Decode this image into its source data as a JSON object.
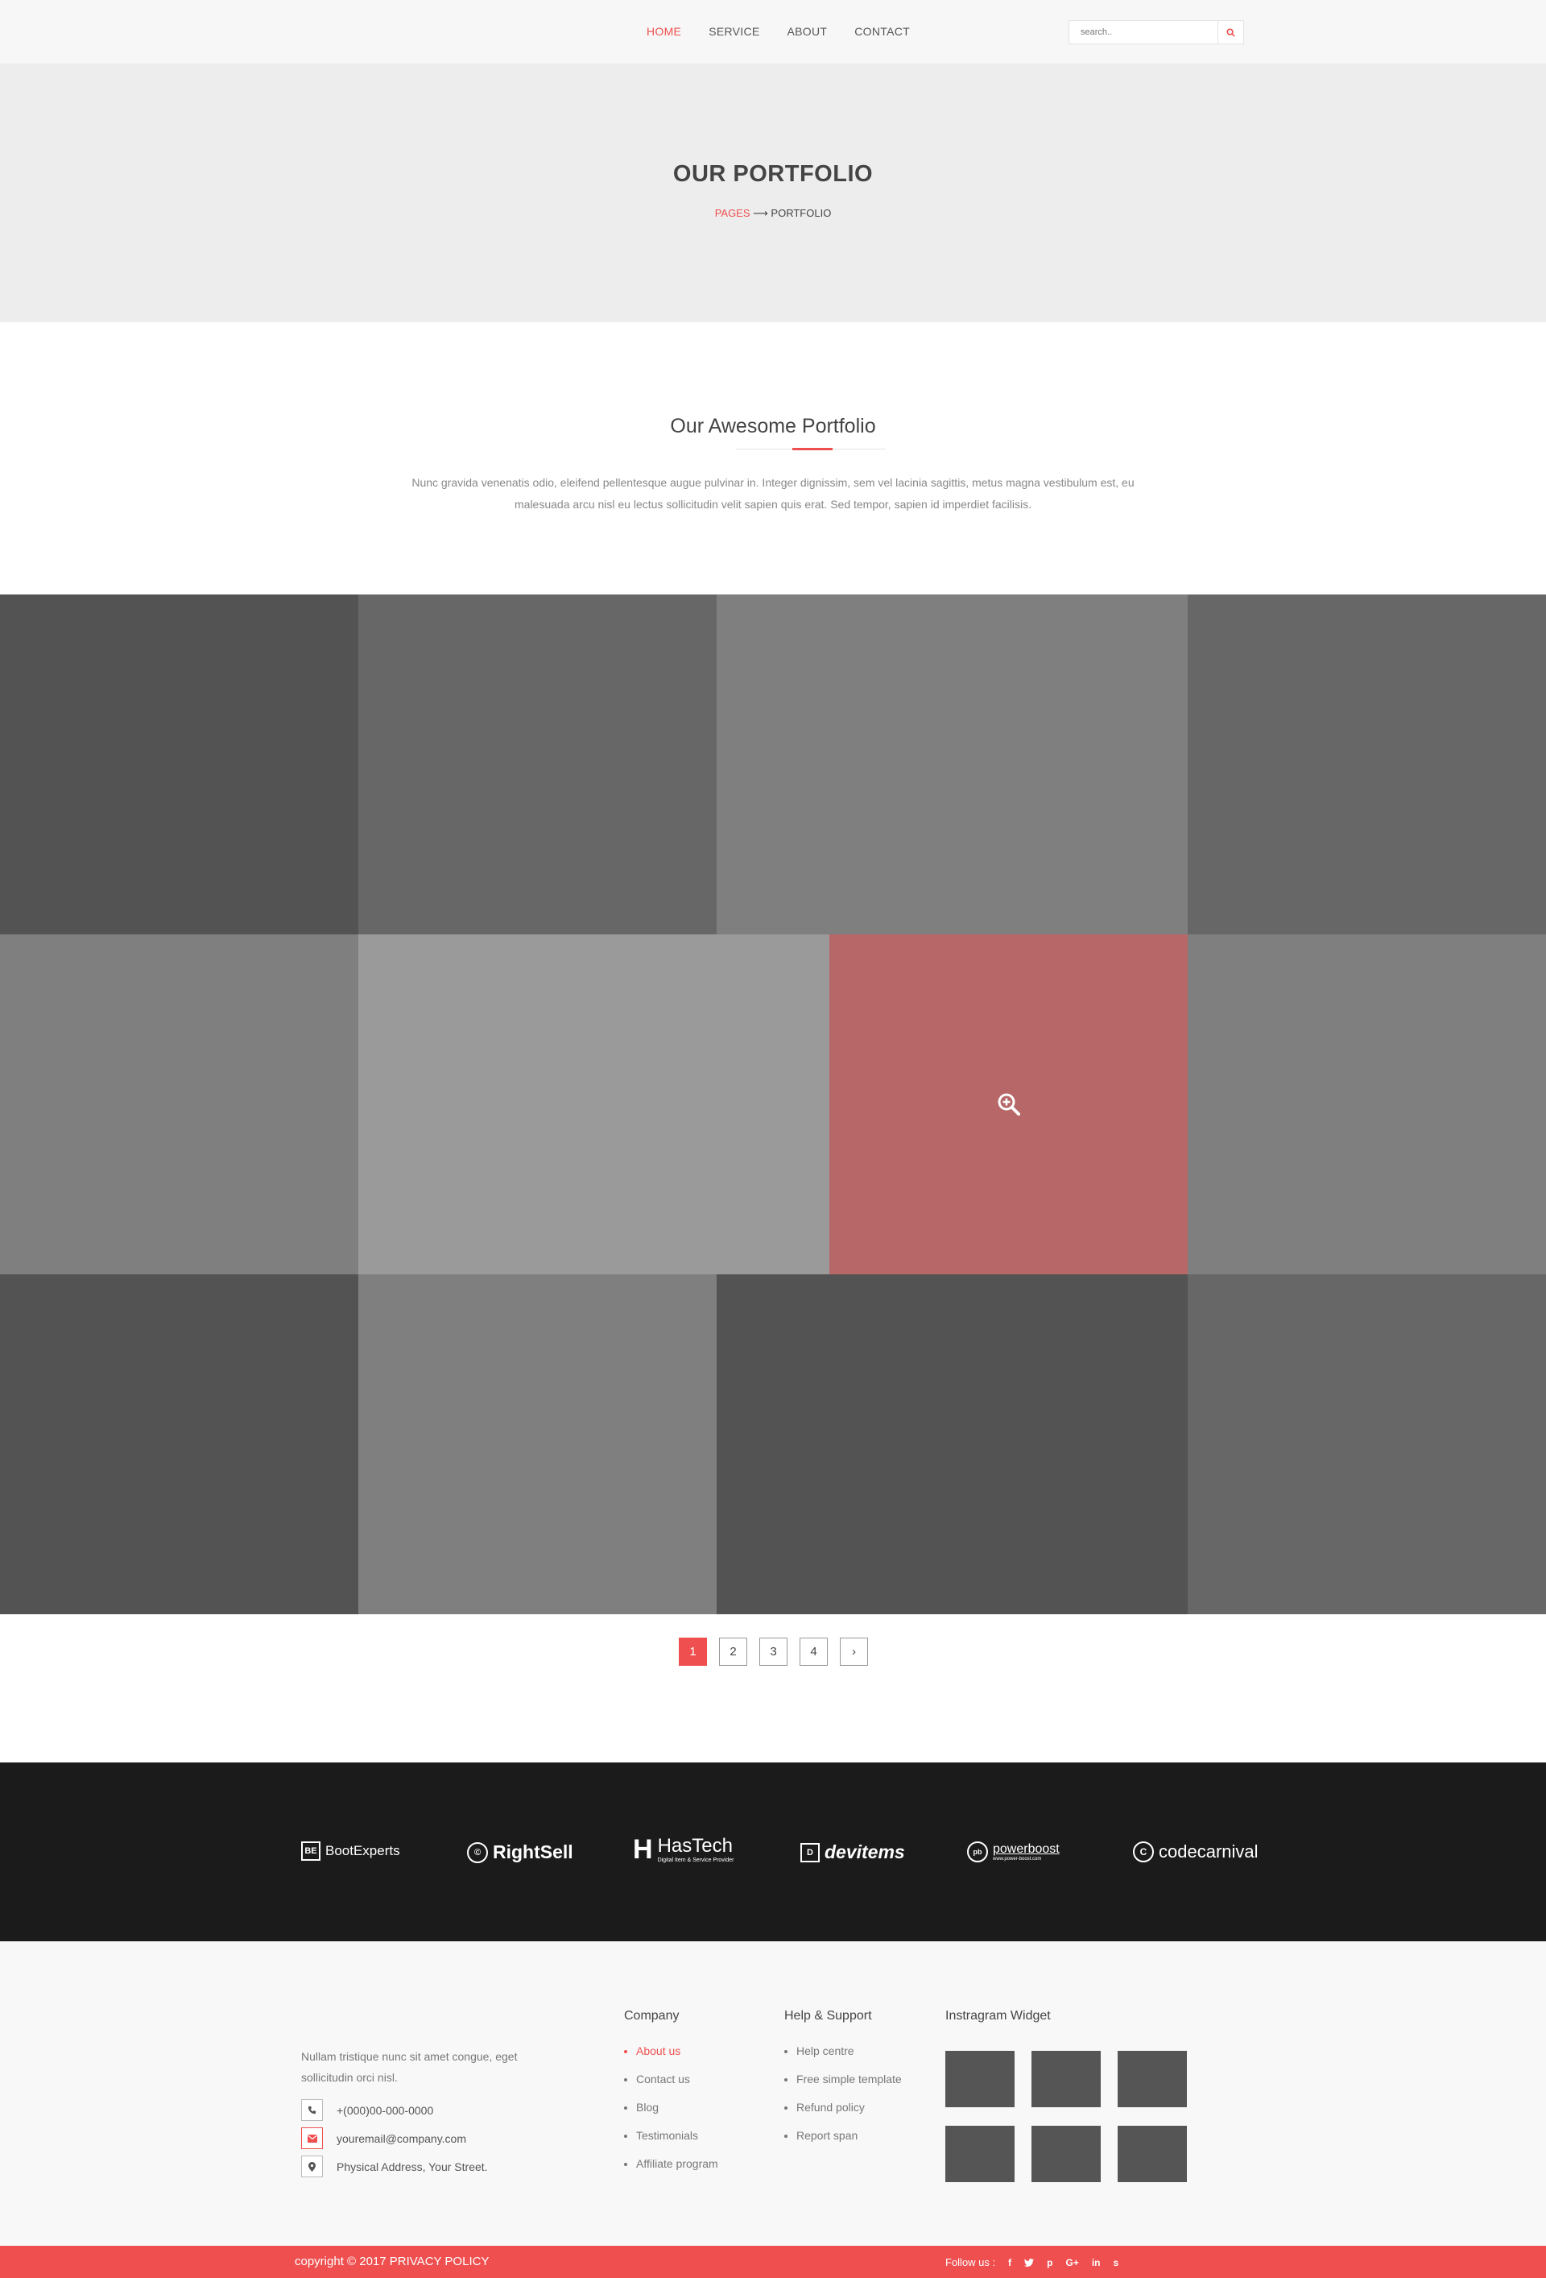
{
  "nav": {
    "items": [
      {
        "label": "HOME",
        "active": true
      },
      {
        "label": "SERVICE",
        "active": false
      },
      {
        "label": "ABOUT",
        "active": false
      },
      {
        "label": "CONTACT",
        "active": false
      }
    ],
    "search_placeholder": "search..",
    "search_icon": "search-icon"
  },
  "banner": {
    "title": "OUR PORTFOLIO",
    "crumb_parent": "PAGES",
    "crumb_arrow": "⟶",
    "crumb_current": "PORTFOLIO"
  },
  "section": {
    "title": "Our Awesome Portfolio",
    "description": "Nunc gravida venenatis odio, eleifend pellentesque augue pulvinar in. Integer dignissim, sem vel lacinia sagittis, metus magna vestibulum est, eu malesuada arcu nisl eu lectus sollicitudin velit sapien quis erat. Sed tempor, sapien id imperdiet facilisis."
  },
  "portfolio": {
    "hover_icon": "zoom-in-icon",
    "colors": {
      "dark": "#535353",
      "mid_dark": "#676767",
      "mid": "#7f7f7f",
      "light": "#9a9a9a",
      "hover": "#b76767"
    }
  },
  "pagination": {
    "pages": [
      "1",
      "2",
      "3",
      "4"
    ],
    "current": "1",
    "next_label": "›"
  },
  "brands": [
    "BootExperts",
    "RightSell",
    "HasTech",
    "Digital Item & Service Provider",
    "devitems",
    "powerboost",
    "www.power-boost.com",
    "codecarnival"
  ],
  "footer": {
    "about": "Nullam tristique nunc sit amet  congue, eget sollicitudin orci nisl.",
    "phone": "+(000)00-000-0000",
    "email": "youremail@company.com",
    "address": "Physical Address, Your Street.",
    "company_title": "Company",
    "company_links": [
      "About us",
      "Contact us",
      "Blog",
      "Testimonials",
      "Affiliate program"
    ],
    "help_title": "Help & Support",
    "help_links": [
      "Help centre",
      "Free simple template",
      "Refund  policy",
      "Report span"
    ],
    "instagram_title": "Instragram Widget"
  },
  "bottom": {
    "copyright": "copyright  © 2017 PRIVACY POLICY",
    "follow_label": "Follow us :",
    "social": [
      "f",
      "t",
      "p",
      "G+",
      "in",
      "s"
    ]
  },
  "accent_color": "#ef4f4f"
}
